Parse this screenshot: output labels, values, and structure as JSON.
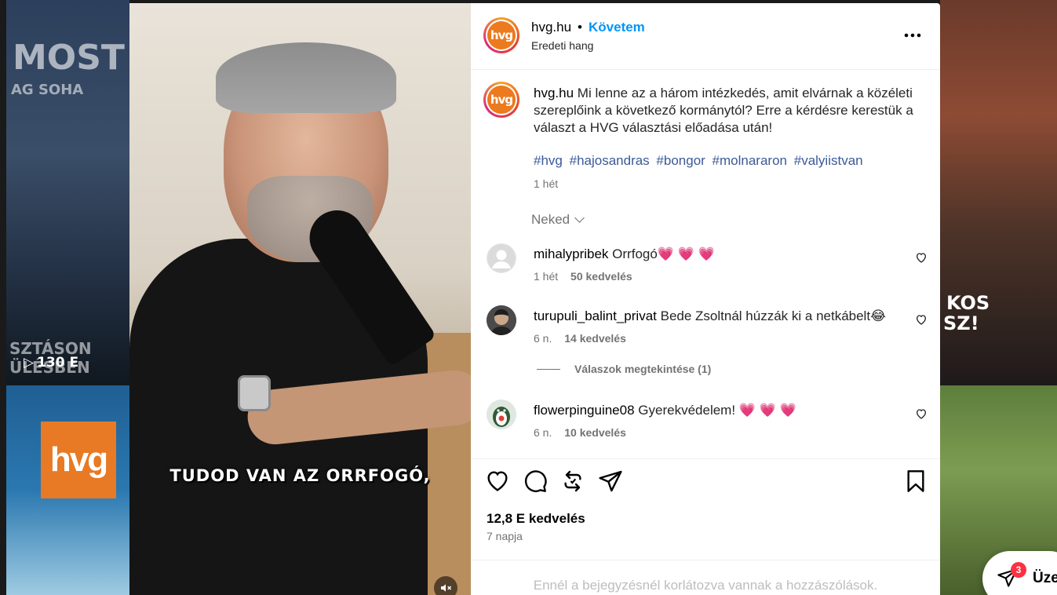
{
  "background": {
    "left_top_text": "MOST",
    "left_top_sub": "AG SOHA",
    "left_mid_text": "SZTÁSON",
    "left_mid_text2": "ÜLÉSBEN",
    "left_views": "130 E",
    "left_bottom_logo": "hvg",
    "right_top_text": "KOS",
    "right_top_text2": "SZ!"
  },
  "video": {
    "caption": "TUDOD VAN AZ ORRFOGÓ,",
    "mute_icon": "muted-speaker-icon"
  },
  "header": {
    "avatar_text": "hvg",
    "username": "hvg.hu",
    "separator": "•",
    "follow_label": "Követem",
    "audio_label": "Eredeti hang",
    "more_icon": "more-options-icon"
  },
  "post": {
    "avatar_text": "hvg",
    "username": "hvg.hu",
    "text": "Mi lenne az a három intézkedés, amit elvárnak a közéleti szereplőink a következő kormánytól? Erre a kérdésre kerestük a választ a HVG választási előadása után!",
    "hashtags": [
      "#hvg",
      "#hajosandras",
      "#bongor",
      "#molnararon",
      "#valyiistvan"
    ],
    "time": "1 hét"
  },
  "comments_sort": {
    "label": "Neked"
  },
  "comments": [
    {
      "username": "mihalypribek",
      "text": "Orrfogó",
      "emoji": "💗 💗 💗",
      "time": "1 hét",
      "likes": "50 kedvelés"
    },
    {
      "username": "turupuli_balint_privat",
      "text": "Bede Zsoltnál húzzák ki a netkábelt",
      "emoji": "😂",
      "time": "6 n.",
      "likes": "14 kedvelés"
    },
    {
      "username": "flowerpinguine08",
      "text": "Gyerekvédelem!",
      "emoji": "💗 💗 💗",
      "time": "6 n.",
      "likes": "10 kedvelés"
    }
  ],
  "view_replies": "Válaszok megtekintése (1)",
  "actions": {
    "like_icon": "heart-icon",
    "comment_icon": "comment-icon",
    "repost_icon": "repost-icon",
    "share_icon": "send-icon",
    "save_icon": "bookmark-icon",
    "likes_count": "12,8 E kedvelés",
    "date": "7 napja",
    "restricted_notice": "Ennél a bejegyzésnél korlátozva vannak a hozzászólások."
  },
  "messages": {
    "badge": "3",
    "label": "Üze"
  },
  "colors": {
    "accent_blue": "#0095f6",
    "hashtag": "#3b5998",
    "heart_pink": "#e8316f",
    "badge_red": "#ff3040",
    "hvg_orange": "#ec7a1e"
  }
}
